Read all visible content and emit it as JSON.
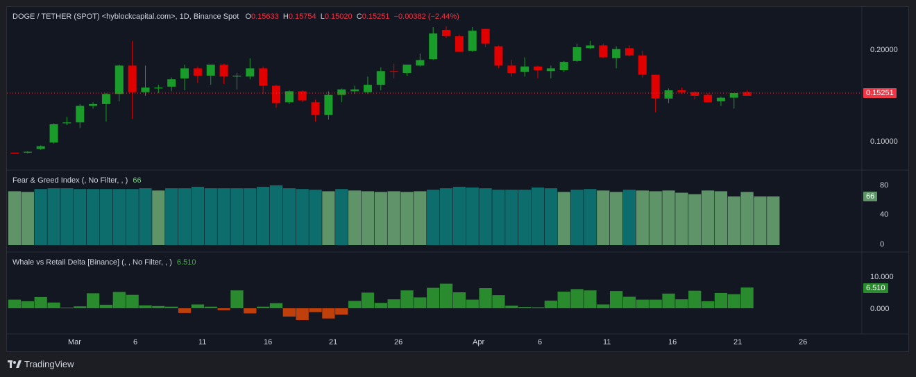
{
  "header": {
    "symbol": "DOGE / TETHER (SPOT) <hyblockcapital.com>, 1D, Binance Spot",
    "o_label": "O",
    "o_value": "0.15633",
    "h_label": "H",
    "h_value": "0.15754",
    "l_label": "L",
    "l_value": "0.15020",
    "c_label": "C",
    "c_value": "0.15251",
    "change": "−0.00382 (−2.44%)"
  },
  "price_axis": {
    "ticks": [
      "0.20000",
      "0.10000"
    ],
    "last_price": "0.15251",
    "last_price_color": "#f23645"
  },
  "colors": {
    "up": "#1a9c2b",
    "down": "#e00000",
    "fng_greed": "#0d6d6d",
    "fng_neutral": "#5f9368",
    "delta_pos": "#2a8a2e",
    "delta_neg": "#c0400b"
  },
  "fear_greed": {
    "title": "Fear & Greed Index (, No Filter, , )",
    "value": "66",
    "ticks": [
      "80",
      "40",
      "0"
    ]
  },
  "whale": {
    "title": "Whale vs Retail Delta [Binance] (, , No Filter, , )",
    "value": "6.510",
    "ticks": [
      "10.000",
      "0.000"
    ]
  },
  "time_axis": {
    "labels": [
      "Mar",
      "6",
      "11",
      "16",
      "21",
      "26",
      "Apr",
      "6",
      "11",
      "16",
      "21",
      "26"
    ]
  },
  "footer": {
    "brand": "TradingView"
  },
  "chart_data": {
    "type": "candlestick",
    "candles": [
      [
        0.088,
        0.088,
        0.087,
        0.087
      ],
      [
        0.088,
        0.0895,
        0.087,
        0.089
      ],
      [
        0.092,
        0.096,
        0.091,
        0.095
      ],
      [
        0.099,
        0.12,
        0.098,
        0.119
      ],
      [
        0.12,
        0.127,
        0.118,
        0.121
      ],
      [
        0.121,
        0.141,
        0.115,
        0.139
      ],
      [
        0.139,
        0.143,
        0.136,
        0.141
      ],
      [
        0.141,
        0.153,
        0.122,
        0.152
      ],
      [
        0.152,
        0.184,
        0.144,
        0.183
      ],
      [
        0.183,
        0.21,
        0.125,
        0.154
      ],
      [
        0.154,
        0.183,
        0.15,
        0.159
      ],
      [
        0.158,
        0.162,
        0.153,
        0.159
      ],
      [
        0.16,
        0.17,
        0.155,
        0.168
      ],
      [
        0.169,
        0.184,
        0.156,
        0.18
      ],
      [
        0.18,
        0.182,
        0.164,
        0.172
      ],
      [
        0.172,
        0.183,
        0.162,
        0.184
      ],
      [
        0.184,
        0.185,
        0.163,
        0.171
      ],
      [
        0.171,
        0.175,
        0.157,
        0.172
      ],
      [
        0.171,
        0.191,
        0.168,
        0.18
      ],
      [
        0.18,
        0.182,
        0.152,
        0.161
      ],
      [
        0.161,
        0.162,
        0.137,
        0.142
      ],
      [
        0.143,
        0.156,
        0.141,
        0.155
      ],
      [
        0.155,
        0.156,
        0.143,
        0.145
      ],
      [
        0.143,
        0.146,
        0.122,
        0.129
      ],
      [
        0.129,
        0.155,
        0.124,
        0.151
      ],
      [
        0.151,
        0.158,
        0.143,
        0.157
      ],
      [
        0.155,
        0.161,
        0.152,
        0.157
      ],
      [
        0.154,
        0.171,
        0.152,
        0.162
      ],
      [
        0.162,
        0.181,
        0.156,
        0.177
      ],
      [
        0.177,
        0.185,
        0.169,
        0.176
      ],
      [
        0.175,
        0.184,
        0.172,
        0.184
      ],
      [
        0.183,
        0.196,
        0.182,
        0.189
      ],
      [
        0.19,
        0.225,
        0.189,
        0.218
      ],
      [
        0.222,
        0.226,
        0.213,
        0.215
      ],
      [
        0.215,
        0.217,
        0.198,
        0.198
      ],
      [
        0.199,
        0.225,
        0.198,
        0.221
      ],
      [
        0.223,
        0.223,
        0.203,
        0.207
      ],
      [
        0.204,
        0.205,
        0.18,
        0.183
      ],
      [
        0.183,
        0.189,
        0.171,
        0.175
      ],
      [
        0.176,
        0.192,
        0.171,
        0.182
      ],
      [
        0.182,
        0.183,
        0.169,
        0.178
      ],
      [
        0.177,
        0.183,
        0.169,
        0.18
      ],
      [
        0.178,
        0.188,
        0.176,
        0.187
      ],
      [
        0.188,
        0.207,
        0.187,
        0.203
      ],
      [
        0.202,
        0.21,
        0.201,
        0.205
      ],
      [
        0.205,
        0.207,
        0.191,
        0.192
      ],
      [
        0.191,
        0.204,
        0.18,
        0.201
      ],
      [
        0.202,
        0.205,
        0.193,
        0.194
      ],
      [
        0.194,
        0.199,
        0.17,
        0.173
      ],
      [
        0.173,
        0.173,
        0.132,
        0.147
      ],
      [
        0.147,
        0.158,
        0.142,
        0.156
      ],
      [
        0.156,
        0.159,
        0.152,
        0.154
      ],
      [
        0.154,
        0.155,
        0.146,
        0.15
      ],
      [
        0.151,
        0.153,
        0.143,
        0.143
      ],
      [
        0.144,
        0.149,
        0.139,
        0.148
      ],
      [
        0.148,
        0.153,
        0.136,
        0.153
      ],
      [
        0.154,
        0.156,
        0.15,
        0.15
      ]
    ],
    "fear_greed": [
      73,
      72,
      76,
      77,
      77,
      76,
      76,
      76,
      76,
      76,
      77,
      74,
      77,
      77,
      79,
      77,
      77,
      77,
      77,
      79,
      81,
      77,
      76,
      75,
      73,
      76,
      74,
      73,
      72,
      73,
      72,
      73,
      75,
      77,
      79,
      78,
      77,
      75,
      75,
      75,
      78,
      77,
      72,
      75,
      76,
      74,
      72,
      75,
      74,
      73,
      74,
      71,
      69,
      74,
      73,
      66,
      72,
      66,
      66
    ],
    "whale_delta": [
      2.7,
      2.2,
      3.5,
      1.8,
      0.2,
      0.6,
      4.7,
      1.1,
      5.1,
      4.2,
      0.9,
      0.7,
      0.5,
      -1.5,
      1.2,
      0.5,
      -0.6,
      5.6,
      -1.6,
      0.5,
      1.6,
      -2.6,
      -3.7,
      -1.2,
      -3.2,
      -2.0,
      2.3,
      4.9,
      1.7,
      2.8,
      5.6,
      3.4,
      6.4,
      7.7,
      5.0,
      2.7,
      6.3,
      4.1,
      0.8,
      0.4,
      0.3,
      2.4,
      5.2,
      6.0,
      5.6,
      1.2,
      5.4,
      3.6,
      2.7,
      2.7,
      4.6,
      2.8,
      5.5,
      2.2,
      4.8,
      4.4,
      6.5
    ]
  }
}
